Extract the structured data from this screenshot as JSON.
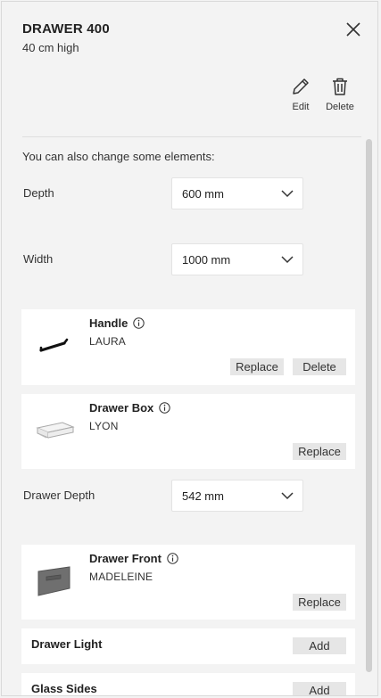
{
  "header": {
    "title": "DRAWER 400",
    "subtitle": "40 cm high",
    "edit_label": "Edit",
    "delete_label": "Delete"
  },
  "options": {
    "intro": "You can also change some elements:",
    "depth_label": "Depth",
    "depth_value": "600 mm",
    "width_label": "Width",
    "width_value": "1000 mm",
    "drawer_depth_label": "Drawer Depth",
    "drawer_depth_value": "542 mm"
  },
  "components": {
    "handle": {
      "name": "Handle",
      "model": "LAURA",
      "replace_label": "Replace",
      "delete_label": "Delete"
    },
    "drawer_box": {
      "name": "Drawer Box",
      "model": "LYON",
      "replace_label": "Replace"
    },
    "drawer_front": {
      "name": "Drawer Front",
      "model": "MADELEINE",
      "replace_label": "Replace"
    },
    "drawer_light": {
      "name": "Drawer Light",
      "add_label": "Add"
    },
    "glass_sides": {
      "name": "Glass Sides",
      "add_label": "Add"
    }
  },
  "icons": {
    "close": "close-icon",
    "edit": "pencil-icon",
    "delete": "trash-icon",
    "info": "info-icon",
    "dropdown": "chevron-down-icon"
  }
}
